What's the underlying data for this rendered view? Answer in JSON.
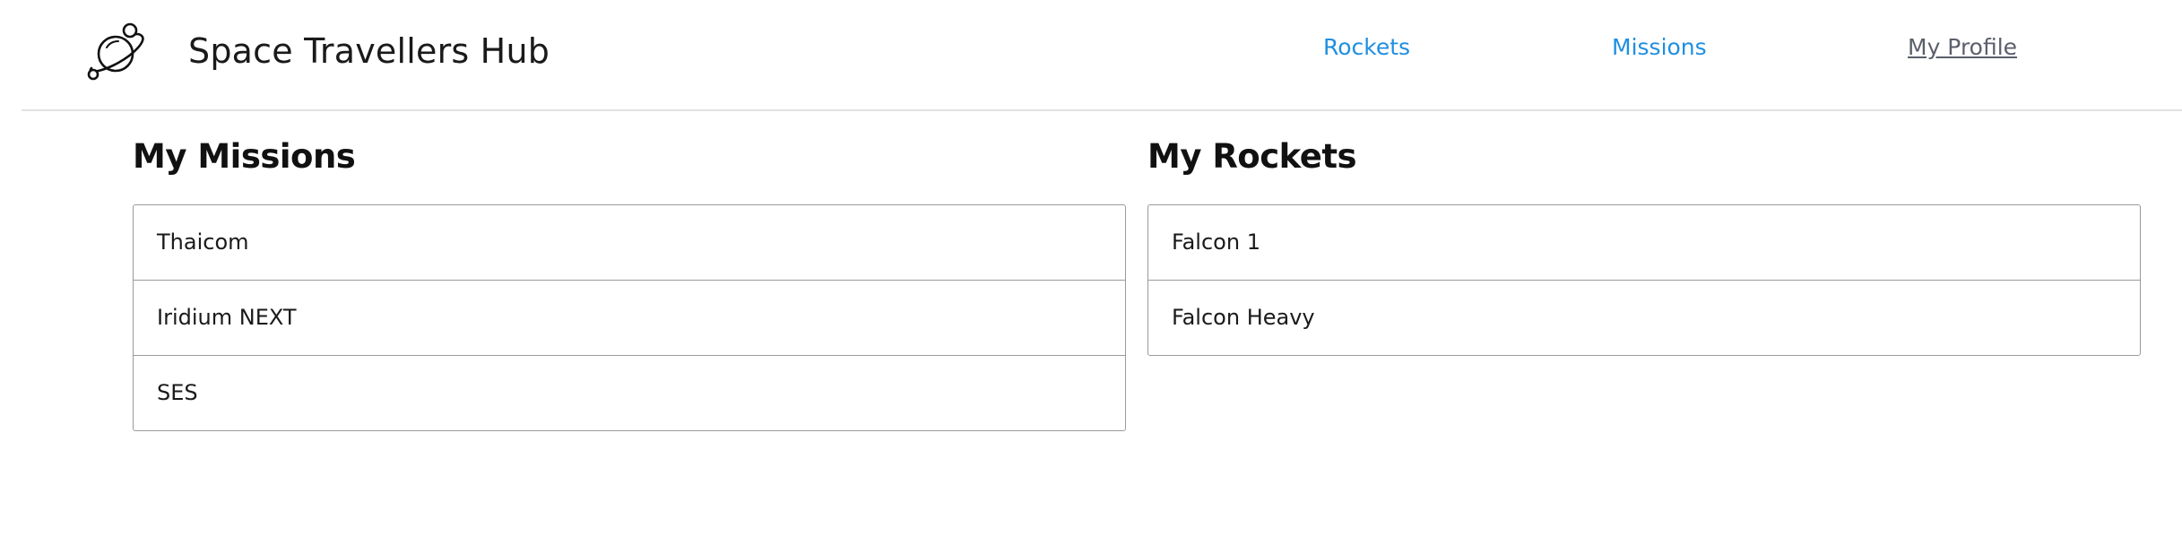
{
  "header": {
    "logo_icon": "planet-icon",
    "title": "Space Travellers Hub",
    "nav": {
      "rockets": "Rockets",
      "missions": "Missions",
      "profile": "My Profile"
    }
  },
  "colors": {
    "nav_link": "#1f8fe0",
    "active_link": "#5b5f6b",
    "border": "#9a9a9a",
    "header_divider": "#e2e2e2"
  },
  "missions": {
    "title": "My Missions",
    "items": [
      "Thaicom",
      "Iridium NEXT",
      "SES"
    ]
  },
  "rockets": {
    "title": "My Rockets",
    "items": [
      "Falcon 1",
      "Falcon Heavy"
    ]
  }
}
